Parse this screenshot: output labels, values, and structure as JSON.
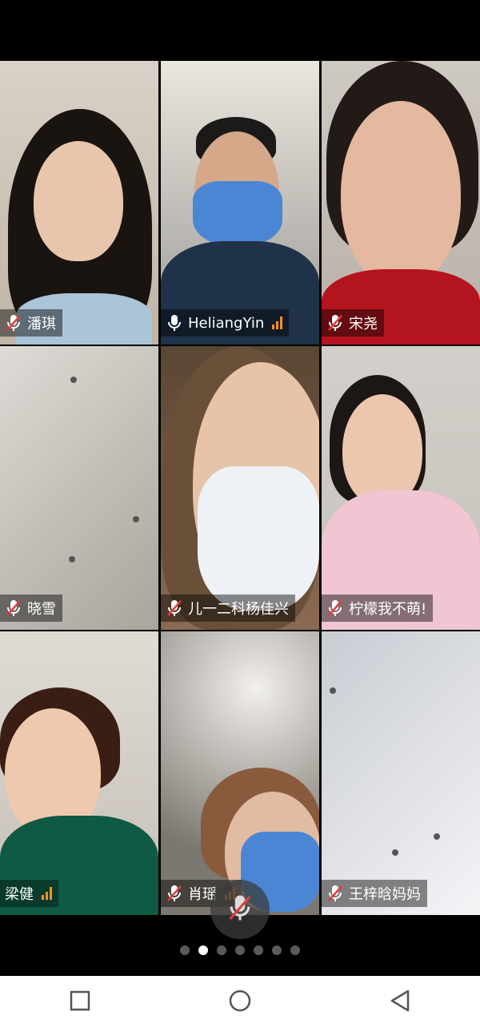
{
  "participants": [
    {
      "name": "潘琪",
      "mic": "muted",
      "signal": false,
      "active": false
    },
    {
      "name": "HeliangYin",
      "mic": "on",
      "signal": true,
      "active": true
    },
    {
      "name": "宋尧",
      "mic": "muted",
      "signal": false,
      "active": false
    },
    {
      "name": "晓雪",
      "mic": "muted",
      "signal": false,
      "active": false
    },
    {
      "name": "儿一二科杨佳兴",
      "mic": "muted",
      "signal": false,
      "active": false
    },
    {
      "name": "柠檬我不萌!",
      "mic": "muted",
      "signal": false,
      "active": false
    },
    {
      "name": "梁健",
      "mic": "none",
      "signal": true,
      "active": false
    },
    {
      "name": "肖瑶",
      "mic": "muted",
      "signal": true,
      "active": false
    },
    {
      "name": "王梓晗妈妈",
      "mic": "muted",
      "signal": false,
      "active": false
    }
  ],
  "pagination": {
    "total": 7,
    "current": 2
  },
  "colors": {
    "active_border": "#4bbf6a",
    "signal": "#f7931e",
    "muted_red": "#e23c3c"
  },
  "icons": {
    "mic_muted": "mic-muted-icon",
    "mic_on": "mic-icon",
    "signal": "signal-bars-icon",
    "nav_recent": "square-icon",
    "nav_home": "circle-icon",
    "nav_back": "triangle-back-icon"
  }
}
